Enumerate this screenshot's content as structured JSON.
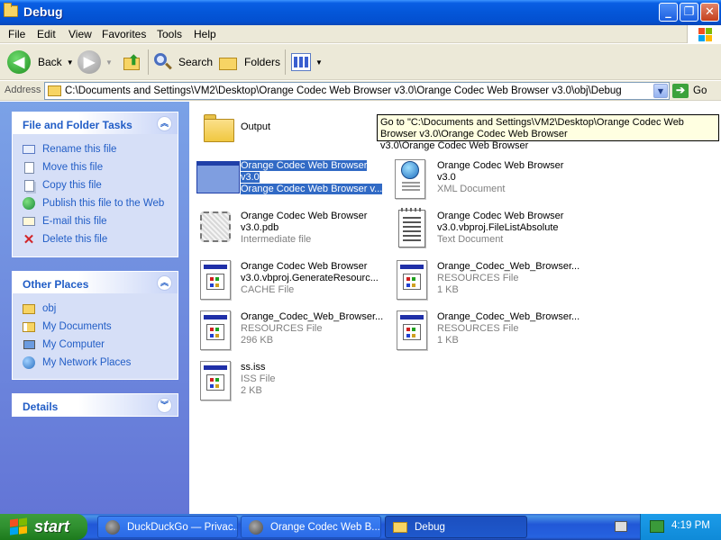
{
  "window": {
    "title": "Debug"
  },
  "menu": [
    "File",
    "Edit",
    "View",
    "Favorites",
    "Tools",
    "Help"
  ],
  "toolbar": {
    "back_label": "Back",
    "search_label": "Search",
    "folders_label": "Folders"
  },
  "address": {
    "label": "Address",
    "path": "C:\\Documents and Settings\\VM2\\Desktop\\Orange Codec Web Browser v3.0\\Orange Codec Web Browser v3.0\\obj\\Debug",
    "go_label": "Go"
  },
  "tasks_panel": {
    "title": "File and Folder Tasks",
    "items": [
      "Rename this file",
      "Move this file",
      "Copy this file",
      "Publish this file to the Web",
      "E-mail this file",
      "Delete this file"
    ]
  },
  "places_panel": {
    "title": "Other Places",
    "items": [
      "obj",
      "My Documents",
      "My Computer",
      "My Network Places"
    ]
  },
  "details_panel": {
    "title": "Details"
  },
  "tooltip": "Go to \"C:\\Documents and Settings\\VM2\\Desktop\\Orange Codec Web Browser v3.0\\Orange Codec Web Browser",
  "tooltip2": "v3.0\\Orange Codec Web Browser",
  "files": [
    {
      "line1": "Output",
      "line2": "",
      "line3": ""
    },
    {
      "line1": "Orange Codec Web Browser",
      "line2": "v3.0",
      "line3": "Orange Codec Web Browser v..."
    },
    {
      "line1": "Orange Codec Web Browser",
      "line2": "v3.0",
      "line3": "XML Document"
    },
    {
      "line1": "Orange Codec Web Browser",
      "line2": "v3.0.pdb",
      "line3": "Intermediate file"
    },
    {
      "line1": "Orange Codec Web Browser",
      "line2": "v3.0.vbproj.FileListAbsolute",
      "line3": "Text Document"
    },
    {
      "line1": "Orange Codec Web Browser",
      "line2": "v3.0.vbproj.GenerateResourc...",
      "line3": "CACHE File"
    },
    {
      "line1": "Orange_Codec_Web_Browser...",
      "line2": "RESOURCES File",
      "line3": "1 KB"
    },
    {
      "line1": "Orange_Codec_Web_Browser...",
      "line2": "RESOURCES File",
      "line3": "296 KB"
    },
    {
      "line1": "Orange_Codec_Web_Browser...",
      "line2": "RESOURCES File",
      "line3": "1 KB"
    },
    {
      "line1": "ss.iss",
      "line2": "ISS File",
      "line3": "2 KB"
    }
  ],
  "taskbar": {
    "start_label": "start",
    "buttons": [
      "DuckDuckGo — Privac...",
      "Orange Codec Web B...",
      "Debug"
    ],
    "clock": "4:19 PM"
  }
}
